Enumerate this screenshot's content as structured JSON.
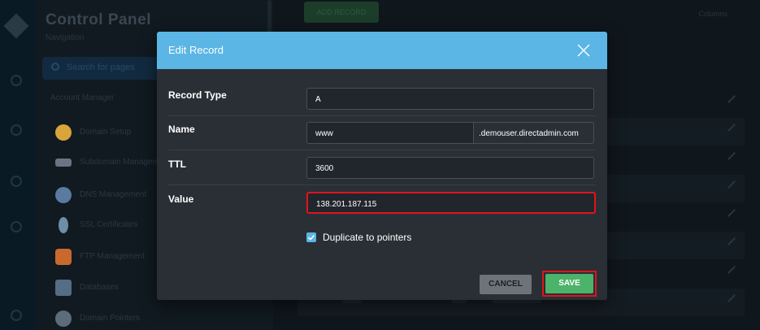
{
  "background": {
    "sidebar": {
      "title": "Control Panel",
      "subtitle": "Navigation",
      "search_placeholder": "Search for pages",
      "section": "Account Manager",
      "items": [
        {
          "label": "Domain Setup",
          "icon": "globe-icon",
          "color": "#d9a43a"
        },
        {
          "label": "Subdomain Management",
          "icon": "subdomain-icon",
          "color": "#6b7480"
        },
        {
          "label": "DNS Management",
          "icon": "dns-icon",
          "color": "#5a7aa0"
        },
        {
          "label": "SSL Certificates",
          "icon": "lightbulb-icon",
          "color": "#6d8ea6"
        },
        {
          "label": "FTP Management",
          "icon": "ftp-icon",
          "color": "#c9692e"
        },
        {
          "label": "Databases",
          "icon": "database-icon",
          "color": "#556d85"
        },
        {
          "label": "Domain Pointers",
          "icon": "pointer-icon",
          "color": "#5e6b78"
        }
      ]
    },
    "toolbar": {
      "add_button": "ADD RECORD",
      "columns": "Columns"
    }
  },
  "modal": {
    "title": "Edit Record",
    "fields": {
      "record_type": {
        "label": "Record Type",
        "value": "A"
      },
      "name": {
        "label": "Name",
        "value": "www",
        "suffix": ".demouser.directadmin.com"
      },
      "ttl": {
        "label": "TTL",
        "value": "3600"
      },
      "value": {
        "label": "Value",
        "value": "138.201.187.115"
      }
    },
    "checkbox": {
      "label": "Duplicate to pointers",
      "checked": true
    },
    "buttons": {
      "cancel": "CANCEL",
      "save": "SAVE"
    }
  },
  "colors": {
    "header": "#5bb5e5",
    "save": "#4cb36a",
    "highlight": "#e0141d"
  }
}
